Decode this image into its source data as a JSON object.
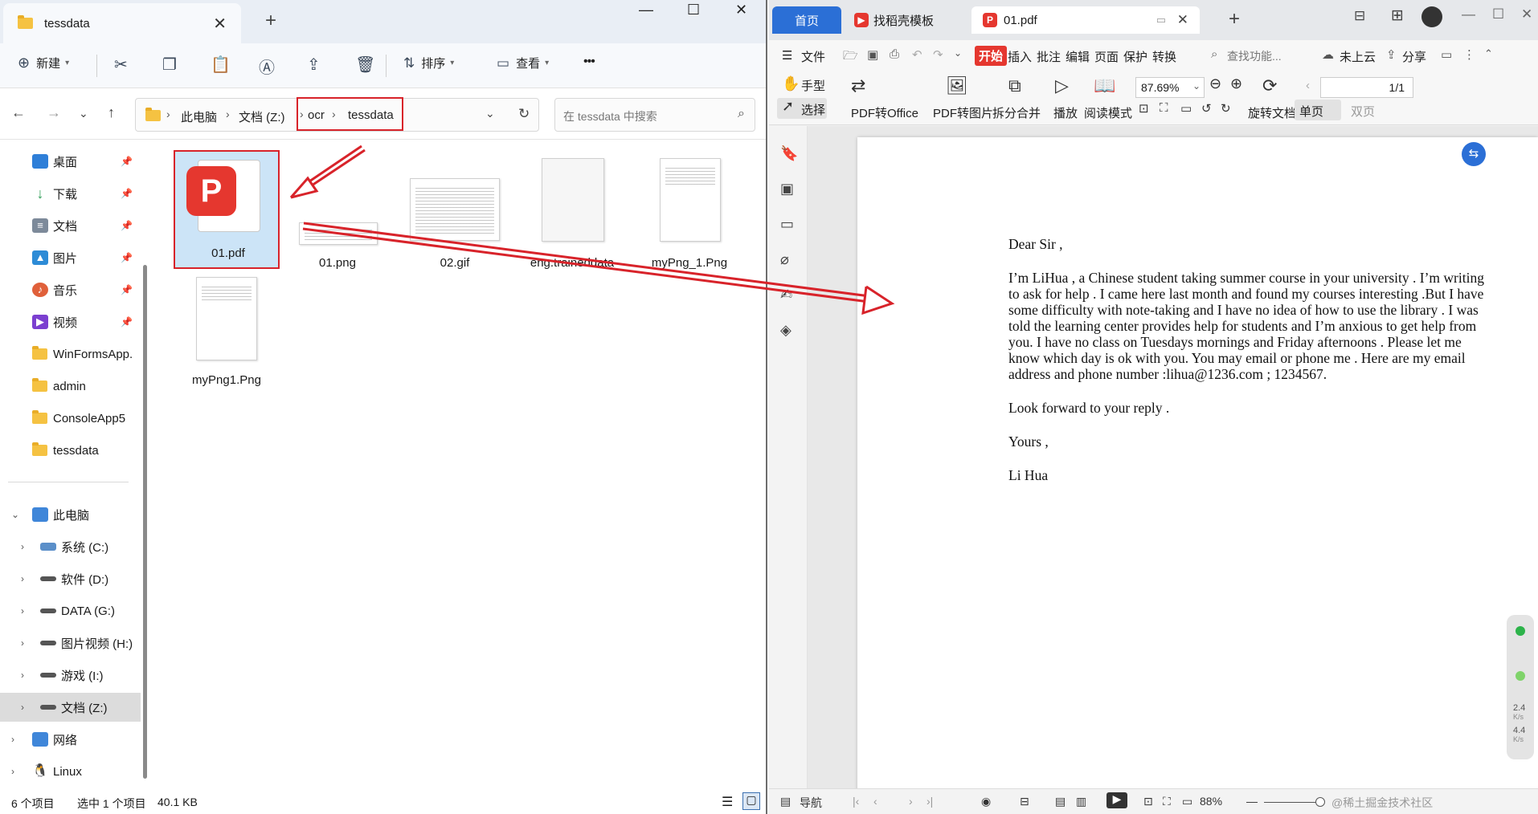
{
  "explorer": {
    "tab_title": "tessdata",
    "toolbar": {
      "new_label": "新建",
      "sort_label": "排序",
      "view_label": "查看",
      "more_label": "•••"
    },
    "address": {
      "crumbs": [
        "此电脑",
        "文档 (Z:)",
        "ocr",
        "tessdata"
      ],
      "search_placeholder": "在 tessdata 中搜索"
    },
    "sidebar": {
      "quick_access": [
        {
          "label": "桌面",
          "color": "#2f7fd8"
        },
        {
          "label": "下载",
          "color": "#2f9d57"
        },
        {
          "label": "文档",
          "color": "#6b7a8c"
        },
        {
          "label": "图片",
          "color": "#2d8bd6"
        },
        {
          "label": "音乐",
          "color": "#e0603a"
        },
        {
          "label": "视频",
          "color": "#7b3fd0"
        },
        {
          "label": "WinFormsApp.",
          "color": "#f5c242"
        },
        {
          "label": "admin",
          "color": "#f5c242"
        },
        {
          "label": "ConsoleApp5",
          "color": "#f5c242"
        },
        {
          "label": "tessdata",
          "color": "#f5c242"
        }
      ],
      "this_pc": "此电脑",
      "drives": [
        "系统 (C:)",
        "软件 (D:)",
        "DATA (G:)",
        "图片视频 (H:)",
        "游戏 (I:)",
        "文档 (Z:)"
      ],
      "network": "网络",
      "linux": "Linux"
    },
    "files": [
      {
        "name": "01.pdf",
        "type": "pdf",
        "selected": true
      },
      {
        "name": "01.png",
        "type": "image"
      },
      {
        "name": "02.gif",
        "type": "image"
      },
      {
        "name": "eng.traineddata",
        "type": "blank"
      },
      {
        "name": "myPng_1.Png",
        "type": "doc"
      },
      {
        "name": "myPng1.Png",
        "type": "doc"
      }
    ],
    "status": {
      "count": "6 个项目",
      "selection": "选中 1 个项目",
      "size": "40.1 KB"
    },
    "highlight_color": "#d8232a"
  },
  "wps": {
    "tabs": {
      "home": "首页",
      "template": "找稻壳模板",
      "doc": "01.pdf"
    },
    "menu": {
      "file": "文件",
      "start": "开始",
      "items": [
        "插入",
        "批注",
        "编辑",
        "页面",
        "保护",
        "转换"
      ],
      "search": "查找功能...",
      "cloud": "未上云",
      "share": "分享"
    },
    "ribbon": {
      "hand": "手型",
      "select": "选择",
      "pdf_to_office": "PDF转Office",
      "pdf_to_image": "PDF转图片",
      "split_merge": "拆分合并",
      "play": "播放",
      "read_mode": "阅读模式",
      "zoom": "87.69%",
      "rotate": "旋转文档",
      "page": "1/1",
      "single": "单页",
      "double": "双页"
    },
    "letter": {
      "greeting": "Dear Sir ,",
      "body": "I’m LiHua , a Chinese student taking summer course in your university . I’m writing to ask for help . I came here last month and found my courses interesting .But I have some difficulty with note-taking and I have no idea of how to use the library . I was told the learning center provides help for students and I’m anxious to get help from you. I have no class on Tuesdays mornings and Friday afternoons . Please let me know which day is ok with you. You may email or phone me . Here are my email address and phone number :lihua@1236.com ; 1234567.",
      "closing_line": "Look forward to your reply .",
      "signoff": "Yours ,",
      "name": "Li Hua"
    },
    "status": {
      "nav": "导航",
      "zoom": "88%",
      "watermark": "@稀土掘金技术社区"
    },
    "net": {
      "up_value": "2.4",
      "up_unit": "K/s",
      "down_value": "4.4",
      "down_unit": "K/s"
    },
    "accent": "#2b6fd6",
    "brand_red": "#e5372f"
  }
}
